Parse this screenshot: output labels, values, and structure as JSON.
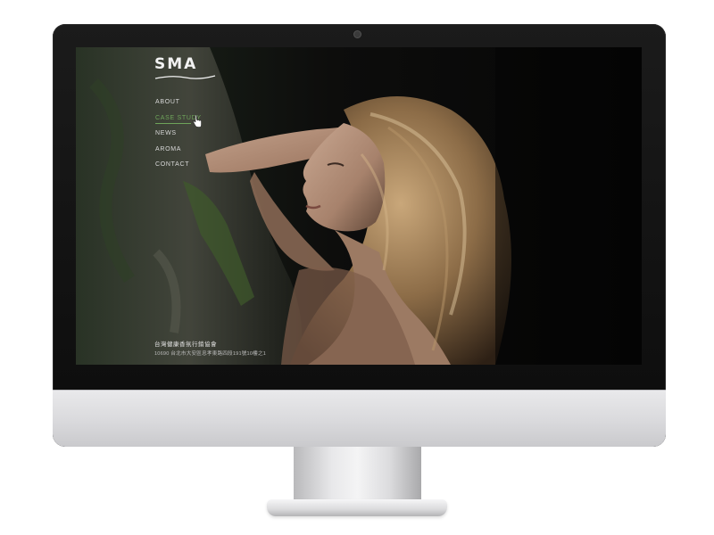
{
  "site": {
    "logo_text": "SMA",
    "nav": [
      {
        "label": "ABOUT"
      },
      {
        "label": "CASE STUDY"
      },
      {
        "label": "NEWS"
      },
      {
        "label": "AROMA"
      },
      {
        "label": "CONTACT"
      }
    ],
    "active_nav": "CASE STUDY",
    "footer": {
      "org_name": "台灣健康香氛行銷協會",
      "address": "10690 台北市大安區忠孝東路四段191號10樓之1"
    }
  },
  "colors": {
    "accent": "#6ea35a",
    "screen_background": "#050505",
    "bezel": "#111111",
    "chin": "#dcdcde"
  },
  "icons": {
    "cursor": "hand-pointer-icon",
    "camera": "camera-dot-icon",
    "logo_mark": "logo-swoosh-icon"
  }
}
